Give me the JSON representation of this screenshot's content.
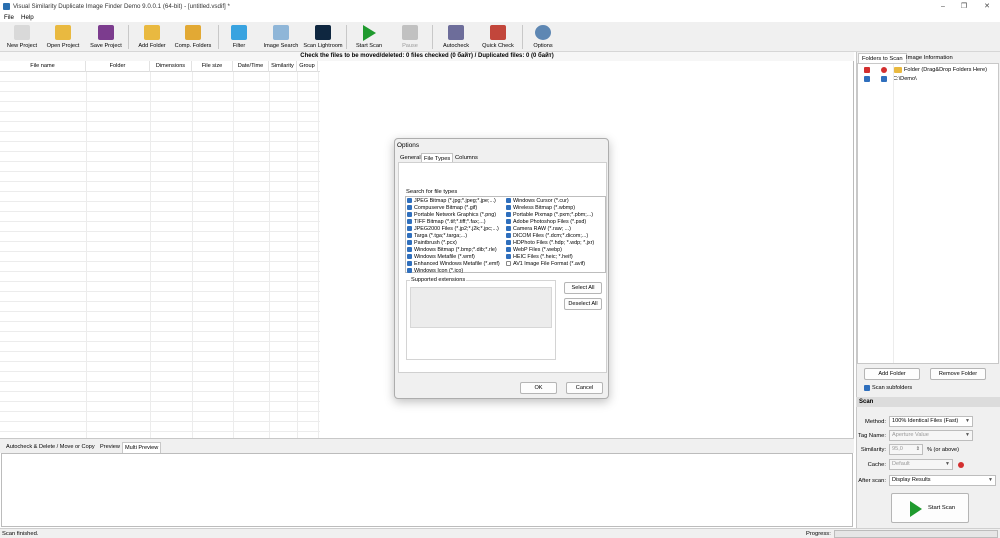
{
  "window": {
    "title": "Visual Similarity Duplicate Image Finder Demo 9.0.0.1 (64-bit) - [untitled.vsdif] *",
    "controls": [
      "–",
      "❐",
      "✕"
    ]
  },
  "menu": [
    "File",
    "Help"
  ],
  "toolbar": [
    {
      "label": "New Project",
      "icon": "new-project-icon",
      "color": "#d9d9d9"
    },
    {
      "label": "Open Project",
      "icon": "open-folder-icon",
      "color": "#e9b940"
    },
    {
      "label": "Save Project",
      "icon": "save-icon",
      "color": "#7c3c8e"
    },
    {
      "label": "Add Folder",
      "icon": "add-folder-icon",
      "color": "#e9b940"
    },
    {
      "label": "Comp. Folders",
      "icon": "compare-folders-icon",
      "color": "#e2a934"
    },
    {
      "label": "Filter",
      "icon": "filter-icon",
      "color": "#39a3e0"
    },
    {
      "label": "Image Search",
      "icon": "magnifier-icon",
      "color": "#8fb6d8"
    },
    {
      "label": "Scan Lightroom",
      "icon": "lightroom-icon",
      "color": "#0f2740"
    },
    {
      "label": "Start Scan",
      "icon": "play-icon",
      "color": "#1f9a2e"
    },
    {
      "label": "Pause",
      "icon": "pause-icon",
      "color": "#9a9a9a"
    },
    {
      "label": "Autocheck",
      "icon": "autocheck-icon",
      "color": "#6d6d9a"
    },
    {
      "label": "Quick Check",
      "icon": "quick-check-icon",
      "color": "#c2463b"
    },
    {
      "label": "Options",
      "icon": "gear-icon",
      "color": "#5e87b3"
    }
  ],
  "results": {
    "banner": "Check the files to be moved/deleted: 0 files checked (0 байт) / Duplicated files: 0 (0 байт)",
    "columns": [
      "File name",
      "Folder",
      "Dimensions",
      "File size",
      "Date/Time",
      "Similarity",
      "Group"
    ]
  },
  "bottom_tabs": [
    "Autocheck & Delete / Move or Copy",
    "Preview",
    "Multi Preview"
  ],
  "status": {
    "text": "Scan finished.",
    "progress_label": "Progress:"
  },
  "right_panel": {
    "tabs": [
      "Folders to Scan",
      "Image Information"
    ],
    "header_row": "Folder (Drag&Drop Folders Here)",
    "folders": [
      "C:\\Demo\\"
    ],
    "add_folder": "Add Folder",
    "remove_folder": "Remove Folder",
    "scan_subfolders": "Scan subfolders",
    "scan_section": "Scan",
    "method_label": "Method:",
    "method_value": "100% Identical Files (Fast)",
    "tag_label": "Tag Name:",
    "tag_value": "Aperture Value",
    "similarity_label": "Similarity:",
    "similarity_value": "95,0",
    "similarity_unit": "% (or above)",
    "cache_label": "Cache:",
    "cache_value": "Default",
    "after_label": "After scan:",
    "after_value": "Display Results",
    "start_scan": "Start Scan"
  },
  "dialog": {
    "title": "Options",
    "tabs": [
      "General",
      "File Types",
      "Columns"
    ],
    "search_label": "Search for file types",
    "file_types_left": [
      {
        "label": "JPEG Bitmap (*.jpg;*.jpeg;*.jpe;...)",
        "checked": true
      },
      {
        "label": "Compuserve Bitmap (*.gif)",
        "checked": true
      },
      {
        "label": "Portable Network Graphics (*.png)",
        "checked": true
      },
      {
        "label": "TIFF Bitmap (*.tif;*.tiff;*.fax;...)",
        "checked": true
      },
      {
        "label": "JPEG2000 Files (*.jp2;*.j2k;*.jpc;...)",
        "checked": true
      },
      {
        "label": "Targa (*.tga;*.targa;...)",
        "checked": true
      },
      {
        "label": "Paintbrush (*.pcx)",
        "checked": true
      },
      {
        "label": "Windows Bitmap (*.bmp;*.dib;*.rle)",
        "checked": true
      },
      {
        "label": "Windows Metafile (*.wmf)",
        "checked": true
      },
      {
        "label": "Enhanced Windows Metafile (*.emf)",
        "checked": true
      },
      {
        "label": "Windows Icon (*.ico)",
        "checked": true
      }
    ],
    "file_types_right": [
      {
        "label": "Windows Cursor (*.cur)",
        "checked": true
      },
      {
        "label": "Wireless Bitmap (*.wbmp)",
        "checked": true
      },
      {
        "label": "Portable Pixmap (*.pxm;*.pbm;...)",
        "checked": true
      },
      {
        "label": "Adobe Photoshop Files (*.psd)",
        "checked": true
      },
      {
        "label": "Camera RAW (*.raw; ...)",
        "checked": true
      },
      {
        "label": "DICOM Files (*.dcm;*.dicom;...)",
        "checked": true
      },
      {
        "label": "HDPhoto Files (*.hdp; *.wdp; *.jxr)",
        "checked": true
      },
      {
        "label": "WebP Files (*.webp)",
        "checked": true
      },
      {
        "label": "HEIC Files (*.heic; *.heif)",
        "checked": true
      },
      {
        "label": "AV1 Image File Format (*.avif)",
        "checked": false
      }
    ],
    "supported_label": "Supported extensions",
    "select_all": "Select All",
    "deselect_all": "Deselect All",
    "ok": "OK",
    "cancel": "Cancel"
  }
}
